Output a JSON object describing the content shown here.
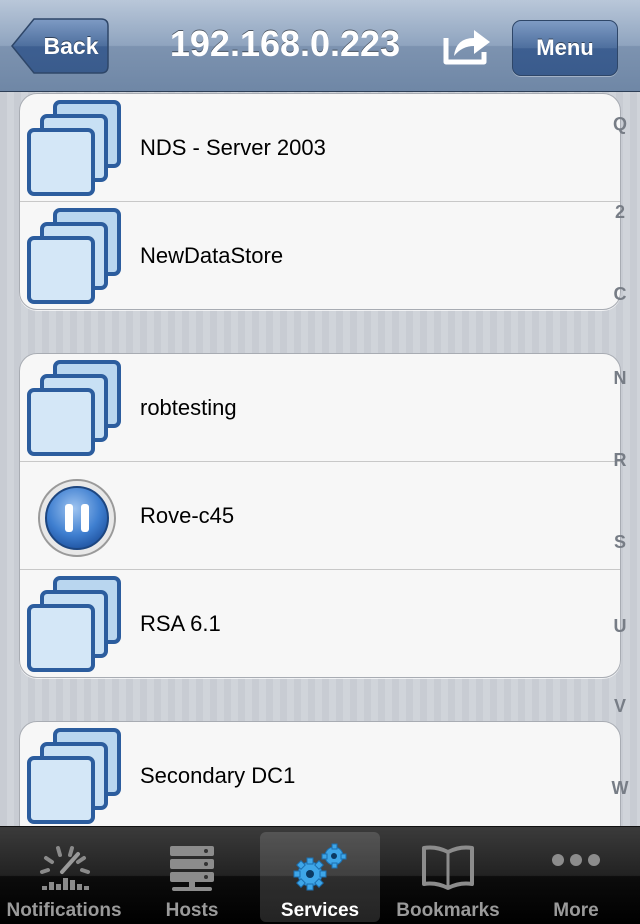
{
  "navbar": {
    "back_label": "Back",
    "title": "192.168.0.223",
    "share_icon": "share-icon",
    "menu_label": "Menu"
  },
  "groups": [
    {
      "rows": [
        {
          "label": "NDS - Server 2003",
          "icon": "vm-stack-icon"
        },
        {
          "label": "NewDataStore",
          "icon": "vm-stack-icon"
        }
      ]
    },
    {
      "rows": [
        {
          "label": "robtesting",
          "icon": "vm-stack-icon"
        },
        {
          "label": "Rove-c45",
          "icon": "paused-vm-icon"
        },
        {
          "label": "RSA 6.1",
          "icon": "vm-stack-icon"
        }
      ]
    },
    {
      "rows": [
        {
          "label": "Secondary DC1",
          "icon": "vm-stack-icon"
        }
      ]
    }
  ],
  "index": [
    "Q",
    "2",
    "C",
    "N",
    "R",
    "S",
    "U",
    "V",
    "W"
  ],
  "tabs": [
    {
      "label": "Notifications",
      "icon": "gauge-icon",
      "active": false
    },
    {
      "label": "Hosts",
      "icon": "server-icon",
      "active": false
    },
    {
      "label": "Services",
      "icon": "gears-icon",
      "active": true
    },
    {
      "label": "Bookmarks",
      "icon": "book-icon",
      "active": false
    },
    {
      "label": "More",
      "icon": "more-dots-icon",
      "active": false
    }
  ],
  "colors": {
    "navbar": "#7d93b0",
    "menu_button": "#3d5f91",
    "active_tab_icon": "#3ea6e8",
    "index_text": "#777d86"
  }
}
